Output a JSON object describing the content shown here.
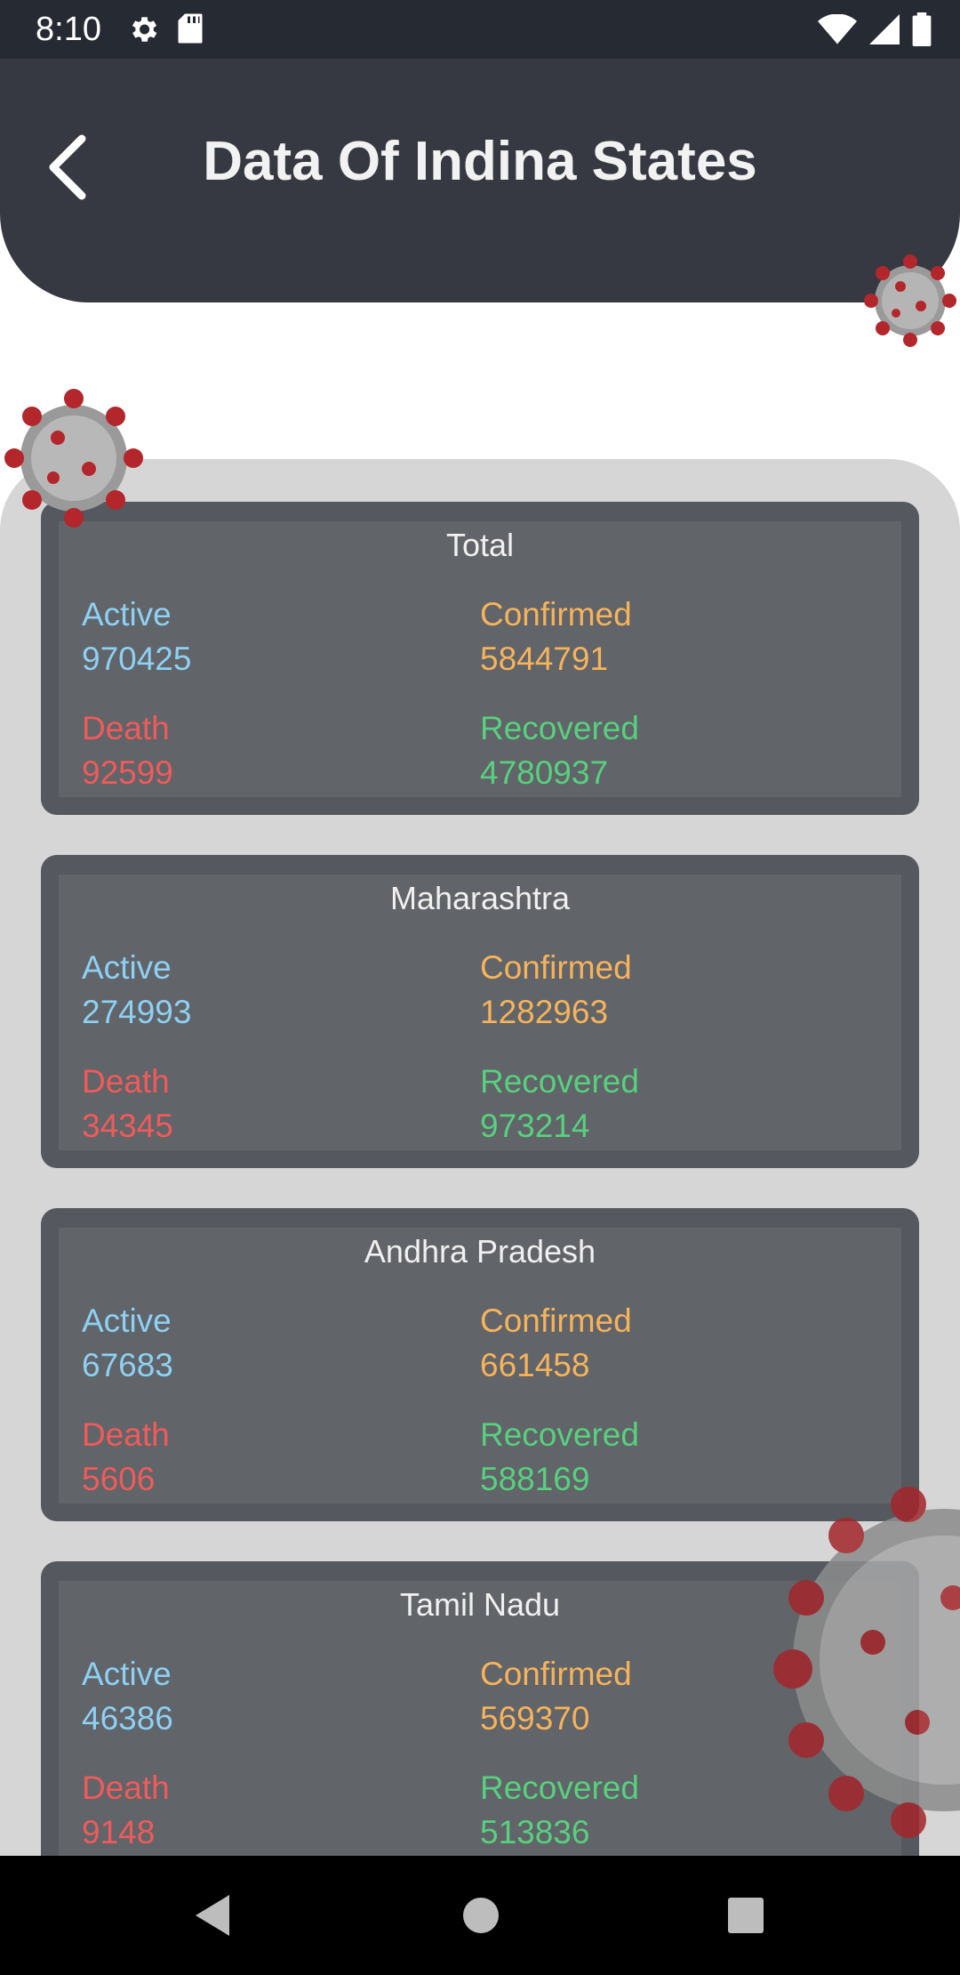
{
  "status_bar": {
    "time": "8:10",
    "icons": [
      "gear-icon",
      "sd-card-icon",
      "wifi-icon",
      "cellular-signal-icon",
      "battery-icon"
    ]
  },
  "header": {
    "title": "Data Of Indina States",
    "back_icon": "chevron-left-icon"
  },
  "labels": {
    "active": "Active",
    "confirmed": "Confirmed",
    "death": "Death",
    "recovered": "Recovered"
  },
  "cards": [
    {
      "name": "Total",
      "active": "970425",
      "confirmed": "5844791",
      "death": "92599",
      "recovered": "4780937"
    },
    {
      "name": "Maharashtra",
      "active": "274993",
      "confirmed": "1282963",
      "death": "34345",
      "recovered": "973214"
    },
    {
      "name": "Andhra Pradesh",
      "active": "67683",
      "confirmed": "661458",
      "death": "5606",
      "recovered": "588169"
    },
    {
      "name": "Tamil Nadu",
      "active": "46386",
      "confirmed": "569370",
      "death": "9148",
      "recovered": "513836"
    }
  ],
  "colors": {
    "header_bg": "#363942",
    "panel_bg": "#d6d6d6",
    "card_bg": "#616469",
    "active": "#8ed0f2",
    "confirmed": "#f5b35c",
    "death": "#ef5b5b",
    "recovered": "#58d07e"
  },
  "nav_bar": {
    "icons": [
      "back-triangle-icon",
      "home-circle-icon",
      "recents-square-icon"
    ]
  }
}
